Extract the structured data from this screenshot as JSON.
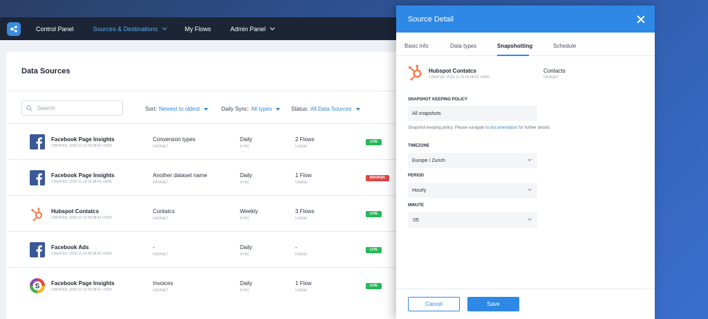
{
  "nav": {
    "items": [
      {
        "label": "Control Panel"
      },
      {
        "label": "Sources & Destinations"
      },
      {
        "label": "My Flows"
      },
      {
        "label": "Admin Panel"
      }
    ]
  },
  "main": {
    "title": "Data Sources",
    "search_placeholder": "Search",
    "filters": {
      "sort_label": "Sort:",
      "sort_value": "Newest to oldest",
      "sync_label": "Daily Sync:",
      "sync_value": "All types",
      "status_label": "Status:",
      "status_value": "All Data Sources"
    },
    "rows": [
      {
        "name": "Facebook Page Insights",
        "created": "CREATED: 2020-11-19 09:08:43 +0000",
        "dataset": "Conversion types",
        "dataset_sub": "DATASET",
        "sync": "Daily",
        "sync_sub": "SYNC",
        "usage": "2 Flows",
        "usage_sub": "USAGE",
        "status": "LIVE",
        "icon": "facebook-icon"
      },
      {
        "name": "Facebook Page Insights",
        "created": "CREATED: 2020-11-19 09:08:43 +0000",
        "dataset": "Another dataset name",
        "dataset_sub": "DATASET",
        "sync": "Daily",
        "sync_sub": "SYNC",
        "usage": "1 Flow",
        "usage_sub": "USAGE",
        "status": "BROKEN",
        "icon": "facebook-icon"
      },
      {
        "name": "Hubspot Contatcs",
        "created": "CREATED: 2020-11-19 09:08:43 +0000",
        "dataset": "Contatcs",
        "dataset_sub": "DATASET",
        "sync": "Weekly",
        "sync_sub": "SYNC",
        "usage": "3 Flows",
        "usage_sub": "USAGE",
        "status": "LIVE",
        "icon": "hubspot-icon"
      },
      {
        "name": "Facebook Ads",
        "created": "CREATED: 2020-11-19 09:08:43 +0000",
        "dataset": "-",
        "dataset_sub": "DATASET",
        "sync": "Daily",
        "sync_sub": "SYNC",
        "usage": "-",
        "usage_sub": "USAGE",
        "status": "LIVE",
        "icon": "facebook-icon"
      },
      {
        "name": "Facebook Page Insights",
        "created": "CREATED: 2020-11-19 09:08:43 +0000",
        "dataset": "Invoices",
        "dataset_sub": "DATASET",
        "sync": "Daily",
        "sync_sub": "SYNC",
        "usage": "1 Flow",
        "usage_sub": "USAGE",
        "status": "LIVE",
        "icon": "s-circle-icon"
      }
    ]
  },
  "modal": {
    "title": "Source Detail",
    "tabs": [
      {
        "label": "Basic info"
      },
      {
        "label": "Data types"
      },
      {
        "label": "Snapshotting"
      },
      {
        "label": "Schedule"
      }
    ],
    "active_tab": "Snapshotting",
    "source": {
      "name": "Hubspot Contatcs",
      "created": "CREATED: 2020-11-19 09:08:43 +0000",
      "dataset": "Contacts",
      "dataset_sub": "DATASET"
    },
    "snapshot_policy_label": "SNAPSHOT KEEPING POLICY",
    "snapshot_policy_value": "All snapshots",
    "help_prefix": "Snapshot keeping policy. Please navigate to ",
    "help_link": "documentation",
    "help_suffix": " for further details.",
    "timezone_label": "TIMEZONE",
    "timezone_value": "Europe / Zurich",
    "period_label": "PERIOD",
    "period_value": "Hourly",
    "minute_label": "MINUTE",
    "minute_value": ":05",
    "cancel_label": "Cancel",
    "save_label": "Save"
  },
  "colors": {
    "accent": "#2e88e5",
    "live": "#27b85a",
    "broken": "#e04444",
    "facebook": "#3b5998",
    "hubspot": "#f57c4f"
  }
}
